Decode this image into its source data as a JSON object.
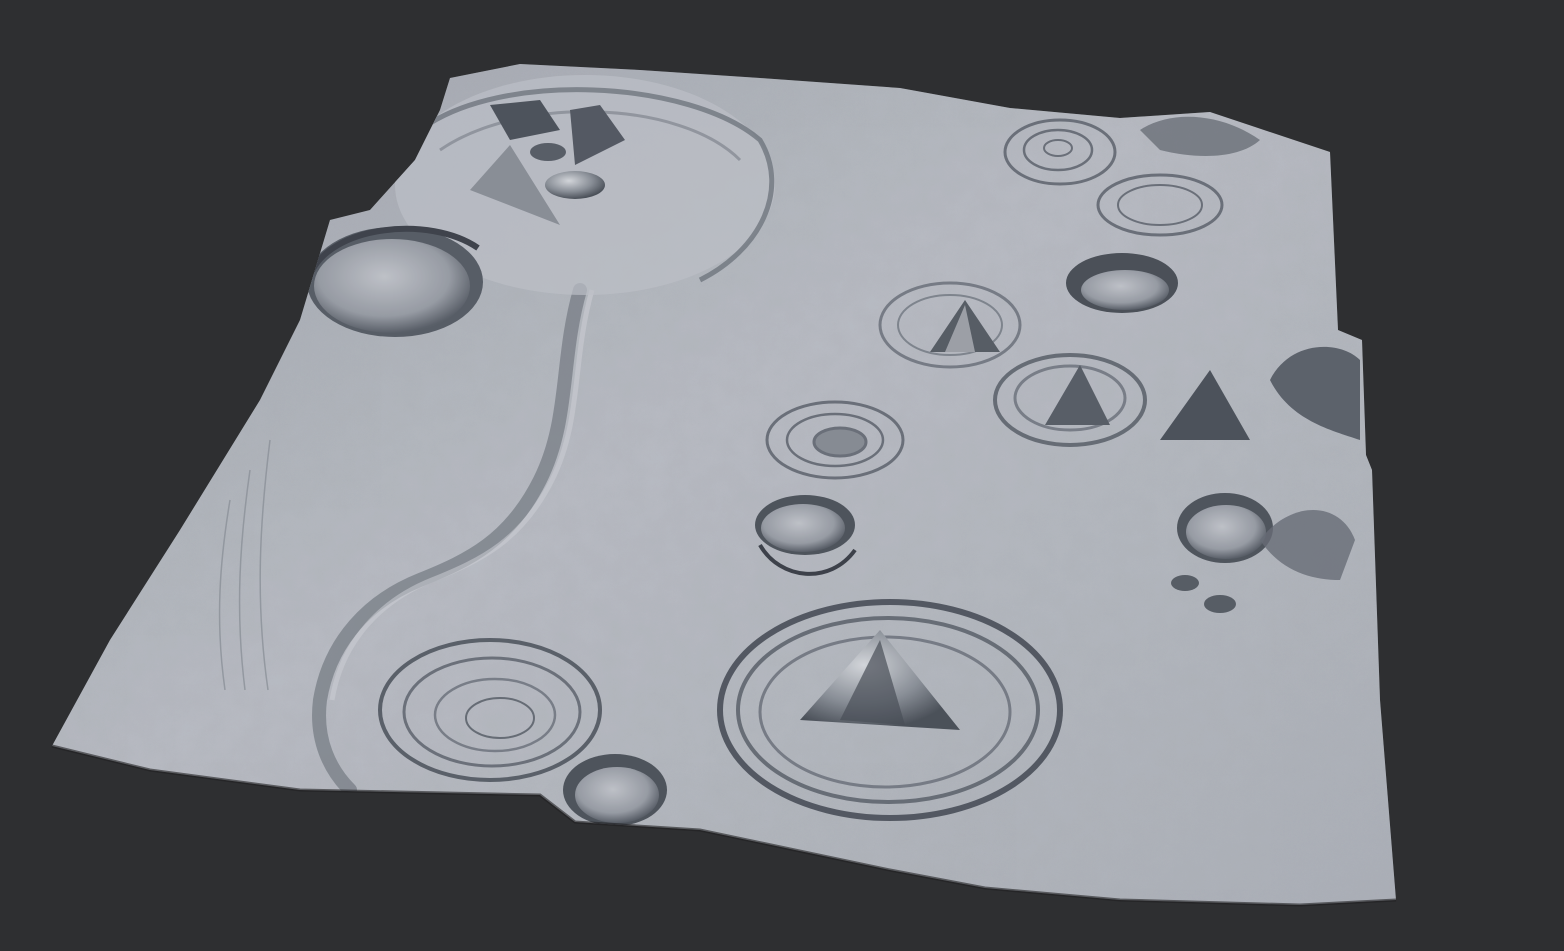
{
  "viewport": {
    "background_color": "#2e2f31"
  },
  "terrain": {
    "material_color": "#b9bdc4",
    "shadow_color": "#4a4f57",
    "highlight_color": "#e6e8ec"
  }
}
